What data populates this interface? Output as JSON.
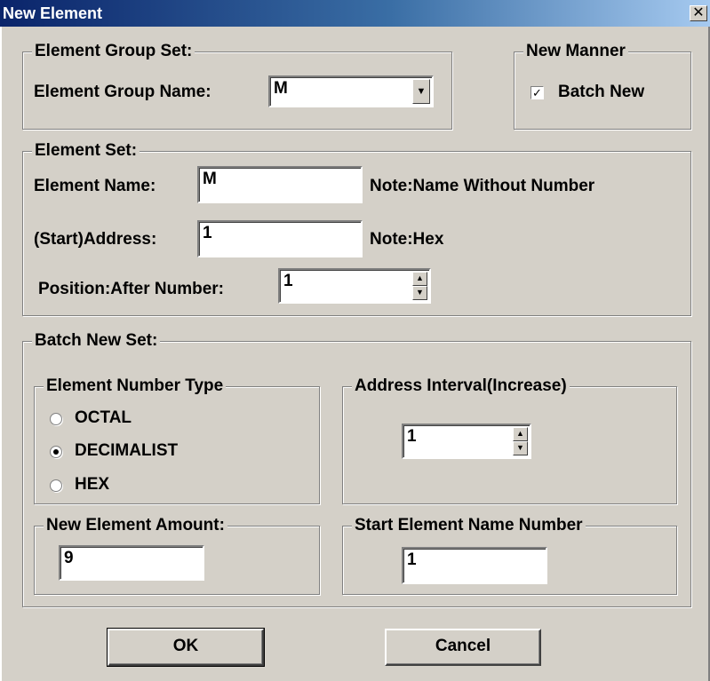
{
  "window": {
    "title": "New Element",
    "close": "✕"
  },
  "element_group_set": {
    "legend": "Element Group Set:",
    "name_label": "Element Group Name:",
    "name_value": "M"
  },
  "new_manner": {
    "legend": "New Manner",
    "batch_label": "Batch New",
    "batch_checked": true
  },
  "element_set": {
    "legend": "Element Set:",
    "name_label": "Element Name:",
    "name_value": "M",
    "name_note": "Note:Name Without Number",
    "address_label": "(Start)Address:",
    "address_value": "1",
    "address_note": "Note:Hex",
    "position_label": "Position:After Number:",
    "position_value": "1"
  },
  "batch_new_set": {
    "legend": "Batch New Set:",
    "number_type": {
      "legend": "Element Number Type",
      "options": [
        "OCTAL",
        "DECIMALIST",
        "HEX"
      ],
      "selected": "DECIMALIST"
    },
    "address_interval": {
      "legend": "Address Interval(Increase)",
      "value": "1"
    },
    "amount": {
      "legend": "New Element Amount:",
      "value": "9"
    },
    "start_number": {
      "legend": "Start Element Name Number",
      "value": "1"
    }
  },
  "buttons": {
    "ok": "OK",
    "cancel": "Cancel"
  },
  "icons": {
    "spin_up": "▲",
    "spin_down": "▼",
    "dropdown": "▼",
    "check": "✓"
  }
}
